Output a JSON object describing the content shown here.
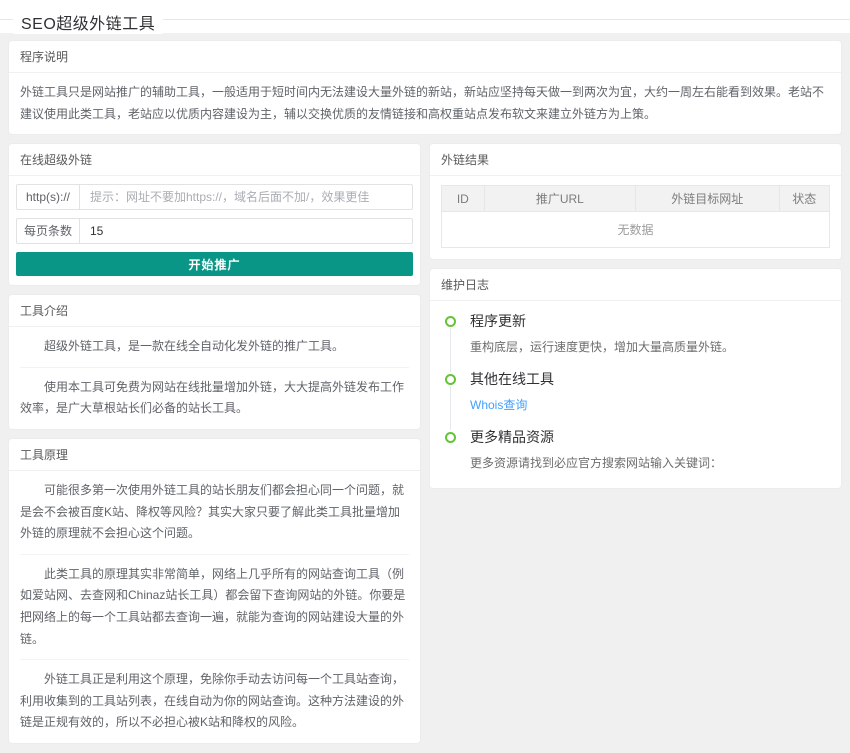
{
  "page": {
    "title": "SEO超级外链工具"
  },
  "colors": {
    "accent_teal": "#0a9687",
    "link_blue": "#409eff",
    "timeline_green": "#67c23a"
  },
  "program_notes": {
    "header": "程序说明",
    "body": "外链工具只是网站推广的辅助工具，一般适用于短时间内无法建设大量外链的新站，新站应坚持每天做一到两次为宜，大约一周左右能看到效果。老站不建议使用此类工具，老站应以优质内容建设为主，辅以交换优质的友情链接和高权重站点发布软文来建立外链方为上策。"
  },
  "form": {
    "header": "在线超级外链",
    "url_label": "http(s)://",
    "url_placeholder": "提示：网址不要加https://，域名后面不加/，效果更佳",
    "per_page_label": "每页条数",
    "per_page_value": "15",
    "submit_label": "开始推广"
  },
  "results": {
    "header": "外链结果",
    "columns": [
      "ID",
      "推广URL",
      "外链目标网址",
      "状态"
    ],
    "empty_text": "无数据"
  },
  "intro": {
    "header": "工具介绍",
    "paragraphs": [
      "超级外链工具，是一款在线全自动化发外链的推广工具。",
      "使用本工具可免费为网站在线批量增加外链，大大提高外链发布工作效率，是广大草根站长们必备的站长工具。"
    ]
  },
  "principle": {
    "header": "工具原理",
    "paragraphs": [
      "可能很多第一次使用外链工具的站长朋友们都会担心同一个问题，就是会不会被百度K站、降权等风险？其实大家只要了解此类工具批量增加外链的原理就不会担心这个问题。",
      "此类工具的原理其实非常简单，网络上几乎所有的网站查询工具（例如爱站网、去查网和Chinaz站长工具）都会留下查询网站的外链。你要是把网络上的每一个工具站都去查询一遍，就能为查询的网站建设大量的外链。",
      "外链工具正是利用这个原理，免除你手动去访问每一个工具站查询，利用收集到的工具站列表，在线自动为你的网站查询。这种方法建设的外链是正规有效的，所以不必担心被K站和降权的风险。"
    ]
  },
  "log": {
    "header": "维护日志",
    "items": [
      {
        "title": "程序更新",
        "desc": "重构底层，运行速度更快，增加大量高质量外链。"
      },
      {
        "title": "其他在线工具",
        "link_label": "Whois查询"
      },
      {
        "title": "更多精品资源",
        "desc": "更多资源请找到必应官方搜索网站输入关键词："
      }
    ]
  }
}
